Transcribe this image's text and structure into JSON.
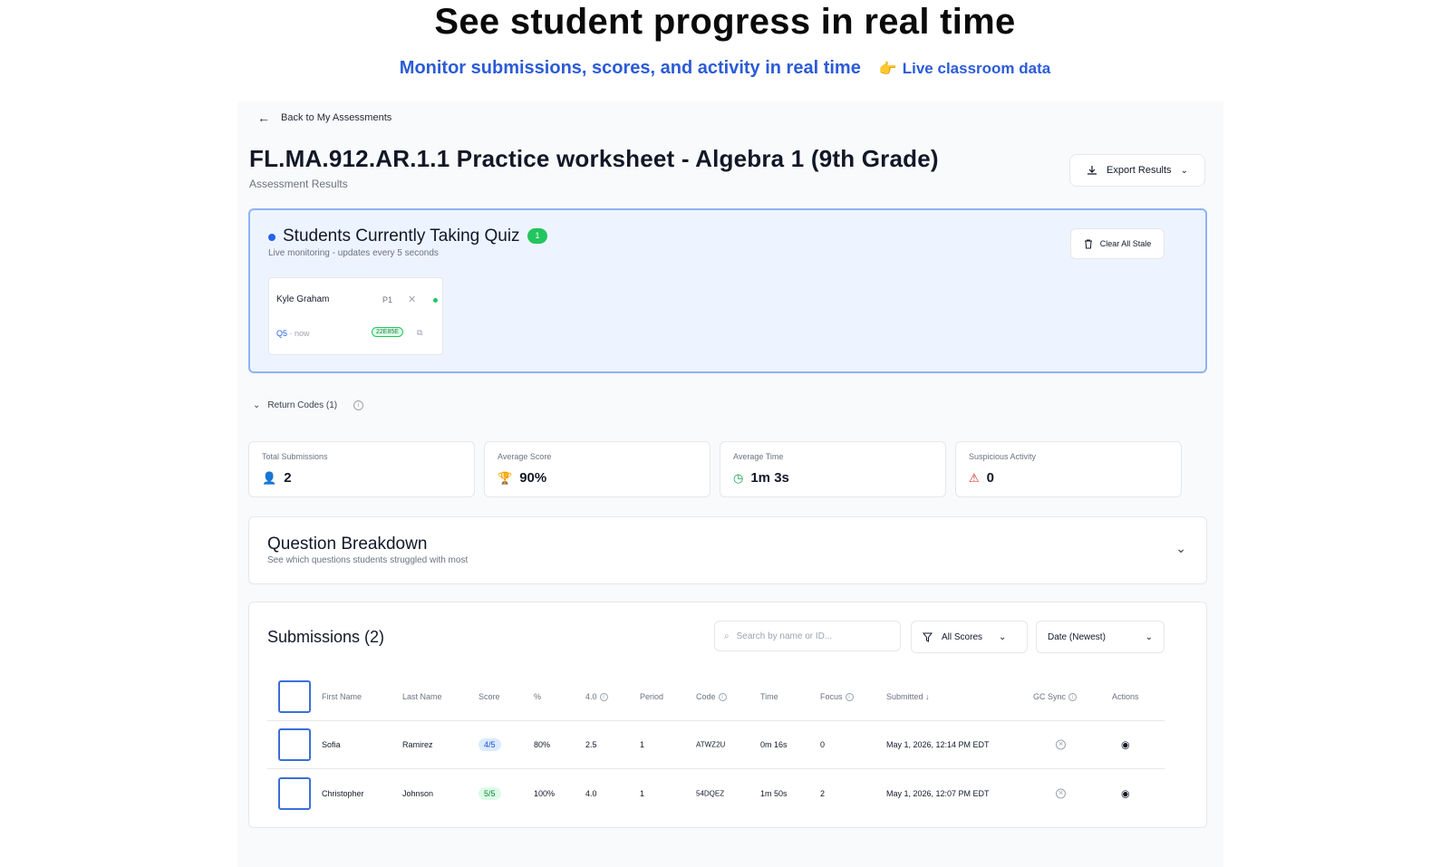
{
  "hero": {
    "title": "See student progress in real time",
    "subtitle": "Monitor submissions, scores, and activity in real time",
    "tag": "Live classroom data",
    "tag_icon": "👉"
  },
  "nav": {
    "back_label": "Back to My Assessments"
  },
  "header": {
    "title": "FL.MA.912.AR.1.1 Practice worksheet - Algebra 1 (9th Grade)",
    "subtitle": "Assessment Results",
    "export_label": "Export Results"
  },
  "live": {
    "title": "Students Currently Taking Quiz",
    "count": "1",
    "subtitle": "Live monitoring - updates every 5 seconds",
    "clear_label": "Clear All Stale",
    "students": [
      {
        "name": "Kyle Graham",
        "period": "P1",
        "question": "Q5",
        "time": "· now",
        "code": "22E85E"
      }
    ]
  },
  "return_codes": {
    "label": "Return Codes (1)"
  },
  "stats": [
    {
      "label": "Total Submissions",
      "value": "2",
      "icon": "user-icon",
      "color": "#2563eb"
    },
    {
      "label": "Average Score",
      "value": "90%",
      "icon": "trophy-icon",
      "color": "#d97706"
    },
    {
      "label": "Average Time",
      "value": "1m 3s",
      "icon": "clock-icon",
      "color": "#16a34a"
    },
    {
      "label": "Suspicious Activity",
      "value": "0",
      "icon": "warning-icon",
      "color": "#dc2626"
    }
  ],
  "breakdown": {
    "title": "Question Breakdown",
    "subtitle": "See which questions students struggled with most"
  },
  "submissions": {
    "title": "Submissions (2)",
    "search_placeholder": "Search by name or ID...",
    "filter_label": "All Scores",
    "sort_label": "Date (Newest)",
    "columns": {
      "first": "First Name",
      "last": "Last Name",
      "score": "Score",
      "pct": "%",
      "gpa": "4.0",
      "period": "Period",
      "code": "Code",
      "time": "Time",
      "focus": "Focus",
      "submitted": "Submitted ↓",
      "gc": "GC Sync",
      "actions": "Actions"
    },
    "rows": [
      {
        "first": "Sofia",
        "last": "Ramirez",
        "score": "4/5",
        "pct": "80%",
        "gpa": "2.5",
        "period": "1",
        "code": "ATWZ2U",
        "time": "0m 16s",
        "focus": "0",
        "submitted": "May 1, 2026, 12:14 PM EDT"
      },
      {
        "first": "Christopher",
        "last": "Johnson",
        "score": "5/5",
        "pct": "100%",
        "gpa": "4.0",
        "period": "1",
        "code": "54DQEZ",
        "time": "1m 50s",
        "focus": "2",
        "submitted": "May 1, 2026, 12:07 PM EDT"
      }
    ]
  },
  "colors": {
    "accent": "#2563eb",
    "live_bg": "#eef4ff",
    "live_border": "#8fb3f5",
    "success": "#22c55e"
  }
}
